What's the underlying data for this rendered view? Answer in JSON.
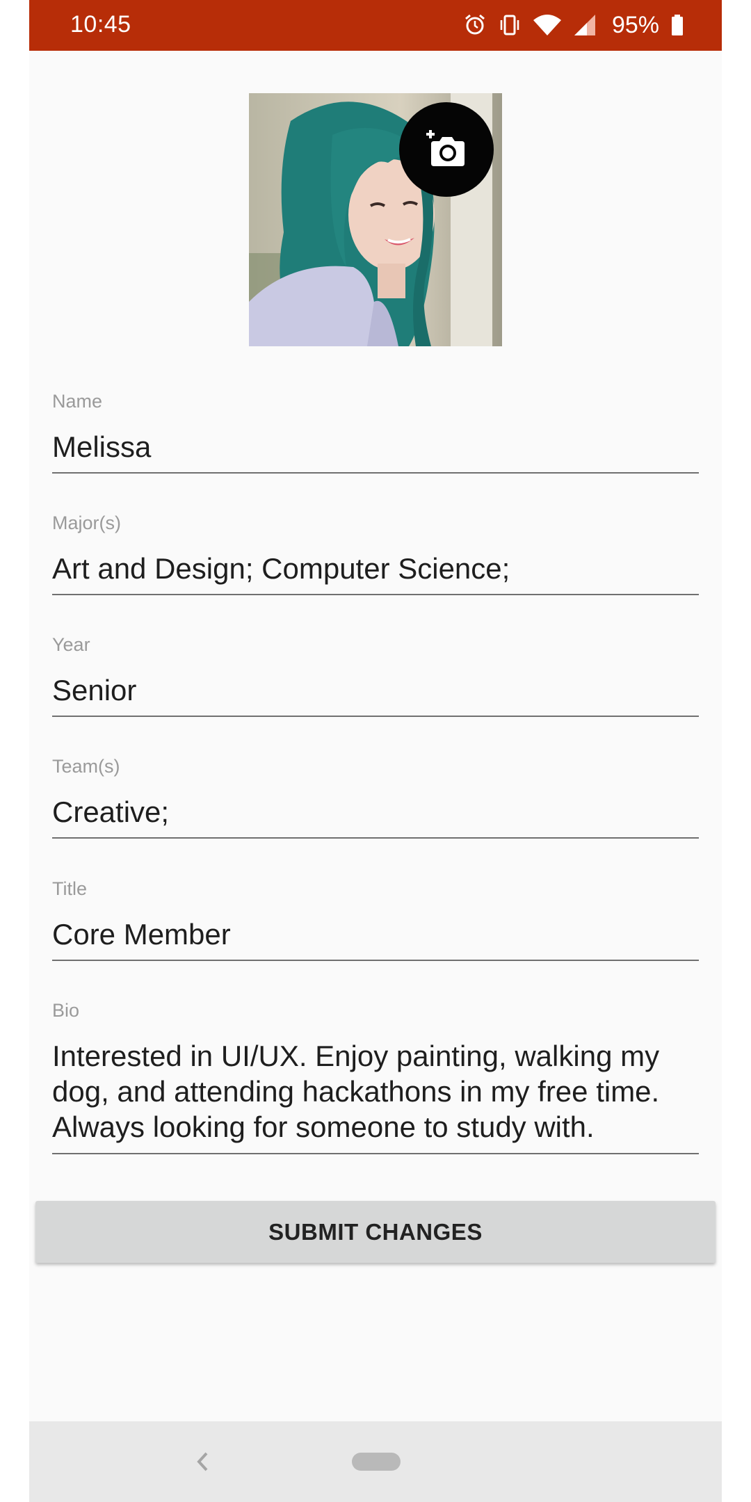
{
  "status_bar": {
    "time": "10:45",
    "battery": "95%",
    "background": "#b72d08",
    "icons": [
      "alarm-icon",
      "vibrate-icon",
      "wifi-icon",
      "signal-icon",
      "battery-icon"
    ]
  },
  "profile": {
    "photo_icon": "portrait-photo",
    "change_photo_icon": "add-photo-camera-icon"
  },
  "fields": {
    "name": {
      "label": "Name",
      "value": "Melissa"
    },
    "majors": {
      "label": "Major(s)",
      "value": "Art and Design; Computer Science;"
    },
    "year": {
      "label": "Year",
      "value": "Senior"
    },
    "teams": {
      "label": "Team(s)",
      "value": "Creative;"
    },
    "title": {
      "label": "Title",
      "value": "Core Member"
    },
    "bio": {
      "label": "Bio",
      "value": "Interested in UI/UX. Enjoy painting, walking my dog, and attending hackathons in my free time. Always looking for someone to study with."
    }
  },
  "submit": {
    "label": "SUBMIT CHANGES"
  },
  "nav_bar": {
    "icons": [
      "back-icon",
      "home-pill-icon"
    ]
  }
}
